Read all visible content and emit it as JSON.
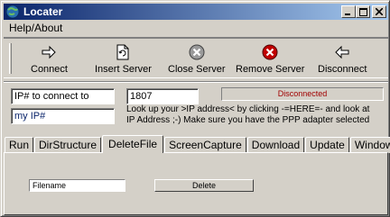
{
  "window": {
    "title": "Locater"
  },
  "menu": {
    "items": [
      "Help/About"
    ]
  },
  "toolbar": {
    "connect": "Connect",
    "insert_server": "Insert Server",
    "close_server": "Close Server",
    "remove_server": "Remove Server",
    "disconnect": "Disconnect"
  },
  "connection": {
    "ip_value": "IP# to connect to",
    "port_value": "1807",
    "status": "Disconnected",
    "my_ip_value": "my IP#",
    "info_line1": "Look up your >IP address< by clicking -=HERE=- and look at",
    "info_line2": "IP Address ;-) Make sure you have the PPP adapter selected"
  },
  "tabs": [
    "Run",
    "DirStructure",
    "DeleteFile",
    "ScreenCapture",
    "Download",
    "Update",
    "Windows"
  ],
  "active_tab": "DeleteFile",
  "delete_panel": {
    "filename_value": "Filename",
    "delete_label": "Delete"
  },
  "colors": {
    "titlebar_start": "#0a246a",
    "titlebar_end": "#a6caf0",
    "status_text": "#a00000",
    "face": "#d4d0c8"
  }
}
